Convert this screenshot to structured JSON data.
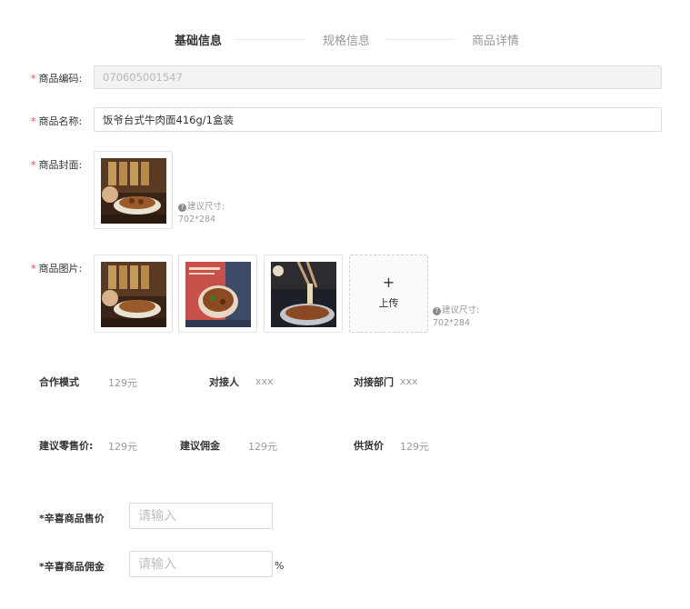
{
  "steps": [
    {
      "label": "基础信息",
      "active": true
    },
    {
      "label": "规格信息",
      "active": false
    },
    {
      "label": "商品详情",
      "active": false
    }
  ],
  "form": {
    "required_mark": "*",
    "code": {
      "label": "商品编码:",
      "value": "070605001547"
    },
    "name": {
      "label": "商品名称:",
      "value": "饭爷台式牛肉面416g/1盒装"
    },
    "cover": {
      "label": "商品封面:",
      "hint_line1": "建议尺寸:",
      "hint_line2": "702*284"
    },
    "images": {
      "label": "商品图片:",
      "upload_plus": "+",
      "upload_label": "上传",
      "hint_line1": "建议尺寸:",
      "hint_line2": "702*284"
    }
  },
  "info_row1": [
    {
      "label": "合作模式",
      "value": "129元"
    },
    {
      "label": "对接人",
      "value": "xxx"
    },
    {
      "label": "对接部门",
      "value": "xxx"
    }
  ],
  "info_row2": [
    {
      "label": "建议零售价:",
      "value": "129元"
    },
    {
      "label": "建议佣金",
      "value": "129元"
    },
    {
      "label": "供货价",
      "value": "129元"
    }
  ],
  "price_field": {
    "label": "*辛喜商品售价",
    "placeholder": "请输入"
  },
  "commission_field": {
    "label": "*辛喜商品佣金",
    "placeholder": "请输入",
    "suffix": "%"
  },
  "colors": {
    "required": "#e5484d",
    "border": "#dcdcdc",
    "muted_text": "#999999"
  },
  "icons": {
    "hint": "question-circle-icon",
    "upload": "plus-icon"
  }
}
